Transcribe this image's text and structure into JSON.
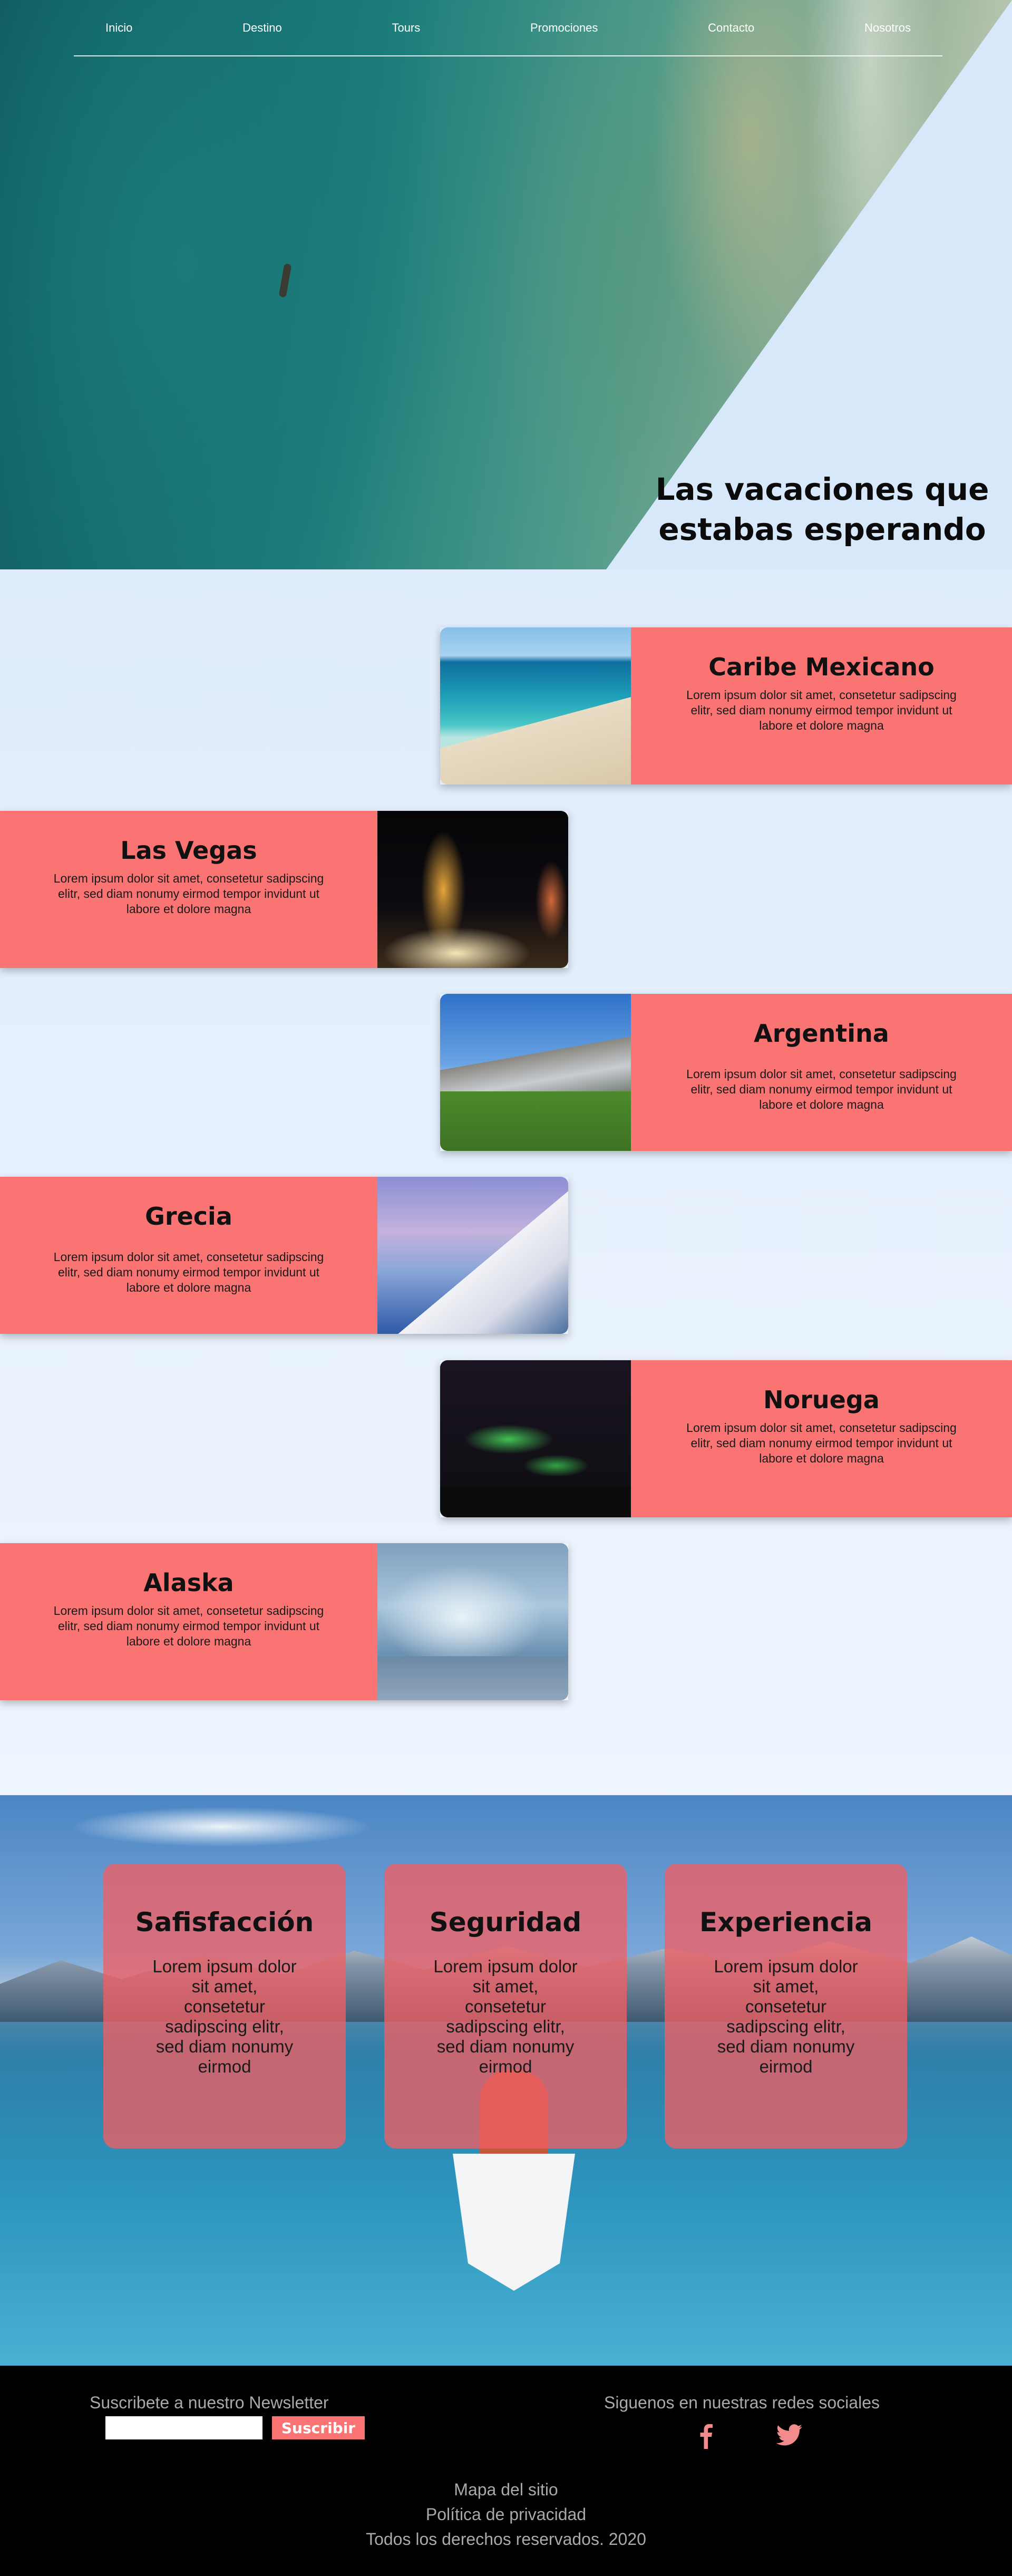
{
  "nav": {
    "items": [
      "Inicio",
      "Destino",
      "Tours",
      "Promociones",
      "Contacto",
      "Nosotros"
    ]
  },
  "hero": {
    "title": "Las vacaciones que estabas esperando"
  },
  "destinations": [
    {
      "title": "Caribe Mexicano",
      "text": "Lorem ipsum dolor sit amet, consetetur sadipscing elitr, sed diam nonumy eirmod tempor invidunt ut labore et dolore magna"
    },
    {
      "title": "Las Vegas",
      "text": "Lorem ipsum dolor sit amet, consetetur sadipscing elitr, sed diam nonumy eirmod tempor invidunt ut labore et dolore magna"
    },
    {
      "title": "Argentina",
      "text": "Lorem ipsum dolor sit amet, consetetur sadipscing elitr, sed diam nonumy eirmod tempor invidunt ut labore et dolore magna"
    },
    {
      "title": "Grecia",
      "text": "Lorem ipsum dolor sit amet, consetetur sadipscing elitr, sed diam nonumy eirmod tempor invidunt ut labore et dolore magna"
    },
    {
      "title": "Noruega",
      "text": "Lorem ipsum dolor sit amet, consetetur sadipscing elitr, sed diam nonumy eirmod tempor invidunt ut labore et dolore magna"
    },
    {
      "title": "Alaska",
      "text": "Lorem ipsum dolor sit amet, consetetur sadipscing elitr, sed diam nonumy eirmod tempor invidunt ut labore et dolore magna"
    }
  ],
  "features": [
    {
      "title": "Safisfacción",
      "text": "Lorem ipsum dolor sit amet, consetetur sadipscing elitr, sed diam nonumy eirmod"
    },
    {
      "title": "Seguridad",
      "text": "Lorem ipsum dolor sit amet, consetetur sadipscing elitr, sed diam nonumy eirmod"
    },
    {
      "title": "Experiencia",
      "text": "Lorem ipsum dolor sit amet, consetetur sadipscing elitr, sed diam nonumy eirmod"
    }
  ],
  "footer": {
    "newsletter_label": "Suscribete a nuestro Newsletter",
    "newsletter_placeholder": "",
    "subscribe_label": "Suscribir",
    "social_label": "Siguenos en nuestras redes sociales",
    "social_icons": [
      "facebook-icon",
      "twitter-icon"
    ],
    "social_color": "#f28b8b",
    "links": [
      "Mapa del sitio",
      "Política de privacidad",
      "Todos los derechos reservados. 2020"
    ]
  },
  "colors": {
    "accent": "#fb7474",
    "hero_background": "#d7e8fb"
  }
}
